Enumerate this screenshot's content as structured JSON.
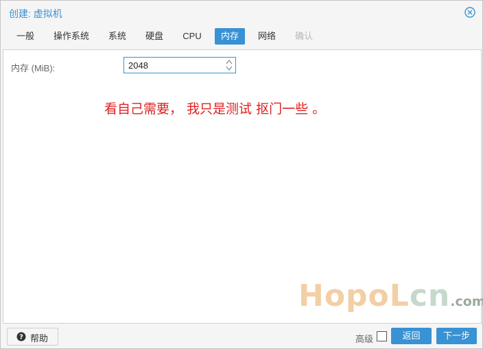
{
  "window": {
    "title": "创建: 虚拟机",
    "close_icon": "close-circle-icon"
  },
  "tabs": [
    {
      "label": "一般",
      "state": "normal"
    },
    {
      "label": "操作系统",
      "state": "normal"
    },
    {
      "label": "系统",
      "state": "normal"
    },
    {
      "label": "硬盘",
      "state": "normal"
    },
    {
      "label": "CPU",
      "state": "normal"
    },
    {
      "label": "内存",
      "state": "active"
    },
    {
      "label": "网络",
      "state": "normal"
    },
    {
      "label": "确认",
      "state": "disabled"
    }
  ],
  "memory": {
    "label": "内存 (MiB):",
    "value": "2048"
  },
  "annotation": "看自己需要， 我只是测试 抠门一些 。",
  "watermark": {
    "part1": "HopoL",
    "part2": "cn",
    "part3": ".com"
  },
  "footer": {
    "help_label": "帮助",
    "advanced_label": "高级",
    "advanced_checked": false,
    "back_label": "返回",
    "next_label": "下一步"
  },
  "colors": {
    "accent": "#3892d4",
    "annotation": "#e02020"
  }
}
